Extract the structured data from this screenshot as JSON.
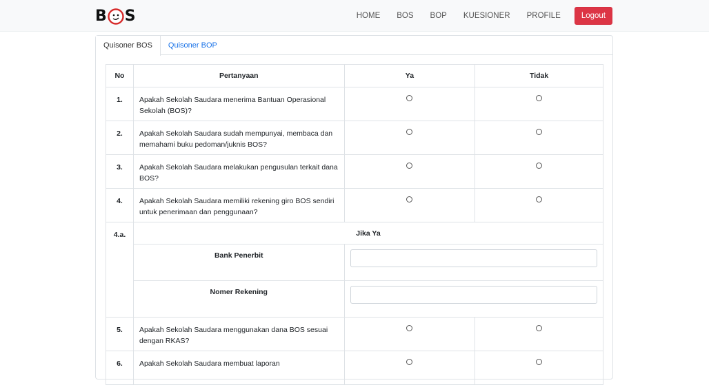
{
  "brand": {
    "letters_left": "B",
    "letters_right": "S"
  },
  "nav": {
    "items": [
      "HOME",
      "BOS",
      "BOP",
      "KUESIONER",
      "PROFILE"
    ],
    "logout": "Logout"
  },
  "tabs": [
    "Quisoner BOS",
    "Quisoner BOP"
  ],
  "table": {
    "headers": [
      "No",
      "Pertanyaan",
      "Ya",
      "Tidak"
    ],
    "rows": [
      {
        "no": "1.",
        "q": "Apakah Sekolah Saudara menerima Bantuan Operasional Sekolah (BOS)?"
      },
      {
        "no": "2.",
        "q": "Apakah Sekolah Saudara sudah mempunyai, membaca dan memahami buku pedoman/juknis BOS?"
      },
      {
        "no": "3.",
        "q": "Apakah Sekolah Saudara melakukan pengusulan terkait dana BOS?"
      },
      {
        "no": "4.",
        "q": "Apakah Sekolah Saudara memiliki rekening giro BOS sendiri untuk penerimaan dan penggunaan?"
      }
    ],
    "sub": {
      "no": "4.a.",
      "heading": "Jika Ya",
      "fields": [
        {
          "label": "Bank Penerbit",
          "value": ""
        },
        {
          "label": "Nomer Rekening",
          "value": ""
        }
      ]
    },
    "rows_after": [
      {
        "no": "5.",
        "q": "Apakah Sekolah Saudara menggunakan dana BOS sesuai dengan RKAS?"
      },
      {
        "no": "6.",
        "q": "Apakah Sekolah Saudara membuat laporan"
      }
    ]
  },
  "colors": {
    "logout": "#dc3545",
    "tab_link": "#1a73e8",
    "navbar_bg": "#f8f9fa"
  }
}
